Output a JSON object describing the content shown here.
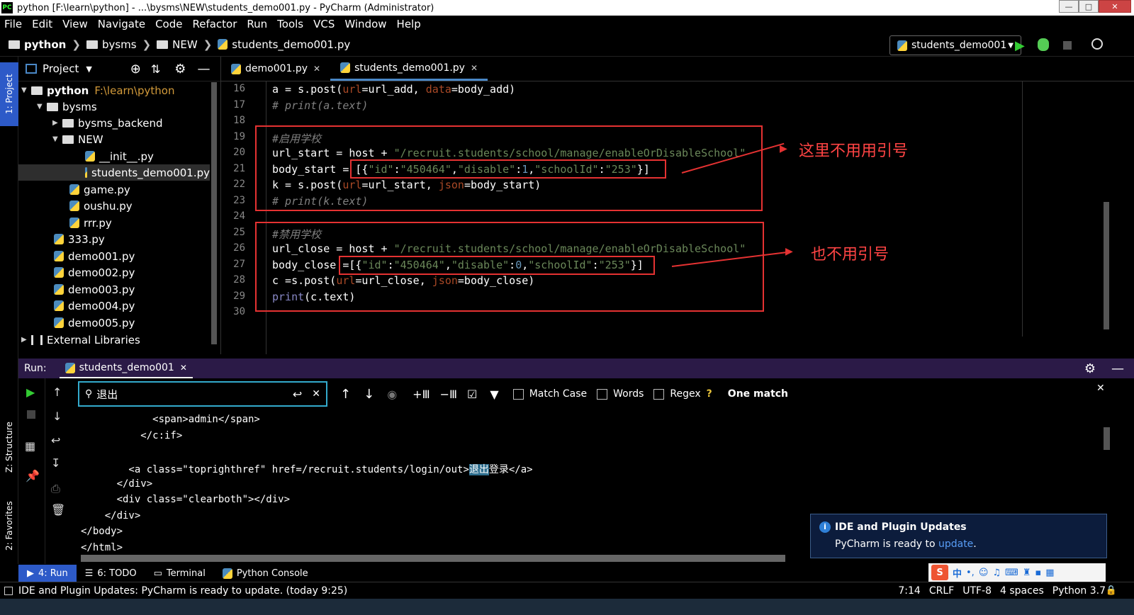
{
  "window": {
    "title": "python [F:\\learn\\python] - ...\\bysms\\NEW\\students_demo001.py - PyCharm (Administrator)"
  },
  "menu": [
    "File",
    "Edit",
    "View",
    "Navigate",
    "Code",
    "Refactor",
    "Run",
    "Tools",
    "VCS",
    "Window",
    "Help"
  ],
  "breadcrumb": [
    "python",
    "bysms",
    "NEW",
    "students_demo001.py"
  ],
  "run_config": "students_demo001",
  "project_panel": {
    "title": "Project",
    "root": "python",
    "root_path": "F:\\learn\\python",
    "items": [
      {
        "label": "bysms",
        "kind": "folder"
      },
      {
        "label": "bysms_backend",
        "kind": "folder"
      },
      {
        "label": "NEW",
        "kind": "folder"
      },
      {
        "label": "__init__.py",
        "kind": "py"
      },
      {
        "label": "students_demo001.py",
        "kind": "py"
      },
      {
        "label": "game.py",
        "kind": "py"
      },
      {
        "label": "oushu.py",
        "kind": "py"
      },
      {
        "label": "rrr.py",
        "kind": "py"
      },
      {
        "label": "333.py",
        "kind": "py"
      },
      {
        "label": "demo001.py",
        "kind": "py"
      },
      {
        "label": "demo002.py",
        "kind": "py"
      },
      {
        "label": "demo003.py",
        "kind": "py"
      },
      {
        "label": "demo004.py",
        "kind": "py"
      },
      {
        "label": "demo005.py",
        "kind": "py"
      },
      {
        "label": "External Libraries",
        "kind": "lib"
      }
    ]
  },
  "left_stripe": {
    "project": "1: Project",
    "structure": "Z: Structure",
    "favorites": "2: Favorites"
  },
  "editor": {
    "tabs": [
      "demo001.py",
      "students_demo001.py"
    ],
    "line_numbers": [
      "16",
      "17",
      "18",
      "19",
      "20",
      "21",
      "22",
      "23",
      "24",
      "25",
      "26",
      "27",
      "28",
      "29",
      "30"
    ],
    "lines": {
      "l16": [
        "a = s.post(",
        "url",
        "=url_add, ",
        "data",
        "=body_add)"
      ],
      "l17": "# print(a.text)",
      "l19": "#启用学校",
      "l20": [
        "url_start = host + ",
        "\"/recruit.students/school/manage/enableOrDisableSchool\""
      ],
      "l21": [
        "body_start = [{",
        "\"id\"",
        ":",
        "\"450464\"",
        ",",
        "\"disable\"",
        ":",
        "1",
        ",",
        "\"schoolId\"",
        ":",
        "\"253\"",
        "}]"
      ],
      "l22": [
        "k = s.post(",
        "url",
        "=url_start, ",
        "json",
        "=body_start)"
      ],
      "l23": "# print(k.text)",
      "l25": "#禁用学校",
      "l26": [
        "url_close = host + ",
        "\"/recruit.students/school/manage/enableOrDisableSchool\""
      ],
      "l27": [
        "body_close =[{",
        "\"id\"",
        ":",
        "\"450464\"",
        ",",
        "\"disable\"",
        ":",
        "0",
        ",",
        "\"schoolId\"",
        ":",
        "\"253\"",
        "}]"
      ],
      "l28": [
        "c =s.post(",
        "url",
        "=url_close, ",
        "json",
        "=body_close)"
      ],
      "l29": [
        "print",
        "(c.text)"
      ]
    },
    "annotations": [
      "这里不用用引号",
      "也不用引号"
    ]
  },
  "run_panel": {
    "label": "Run:",
    "tab": "students_demo001",
    "search_value": "退出",
    "match_case": "Match Case",
    "words": "Words",
    "regex": "Regex",
    "regex_help": "?",
    "result": "One match",
    "console": [
      "            <span>admin</span>",
      "          </c:if>",
      "",
      "        <a class=\"toprighthref\" href=/recruit.students/login/out>",
      "      </div>",
      "      <div class=\"clearboth\"></div>",
      "    </div>",
      "</body>",
      "</html>"
    ],
    "console_match": "退出",
    "console_after": "登录</a>"
  },
  "notification": {
    "title": "IDE and Plugin Updates",
    "body": "PyCharm is ready to ",
    "link": "update",
    "tail": "."
  },
  "bottom_tabs": [
    "4: Run",
    "6: TODO",
    "Terminal",
    "Python Console"
  ],
  "status": {
    "message": "IDE and Plugin Updates: PyCharm is ready to update. (today 9:25)",
    "position": "7:14",
    "line_sep": "CRLF",
    "encoding": "UTF-8",
    "indent": "4 spaces",
    "interpreter": "Python 3.7"
  },
  "ime": {
    "mode": "中"
  },
  "colors": {
    "annotation_red": "#e53232",
    "accent_blue": "#4a88c7",
    "run_header": "#2b1a47",
    "search_border": "#33aacc"
  }
}
